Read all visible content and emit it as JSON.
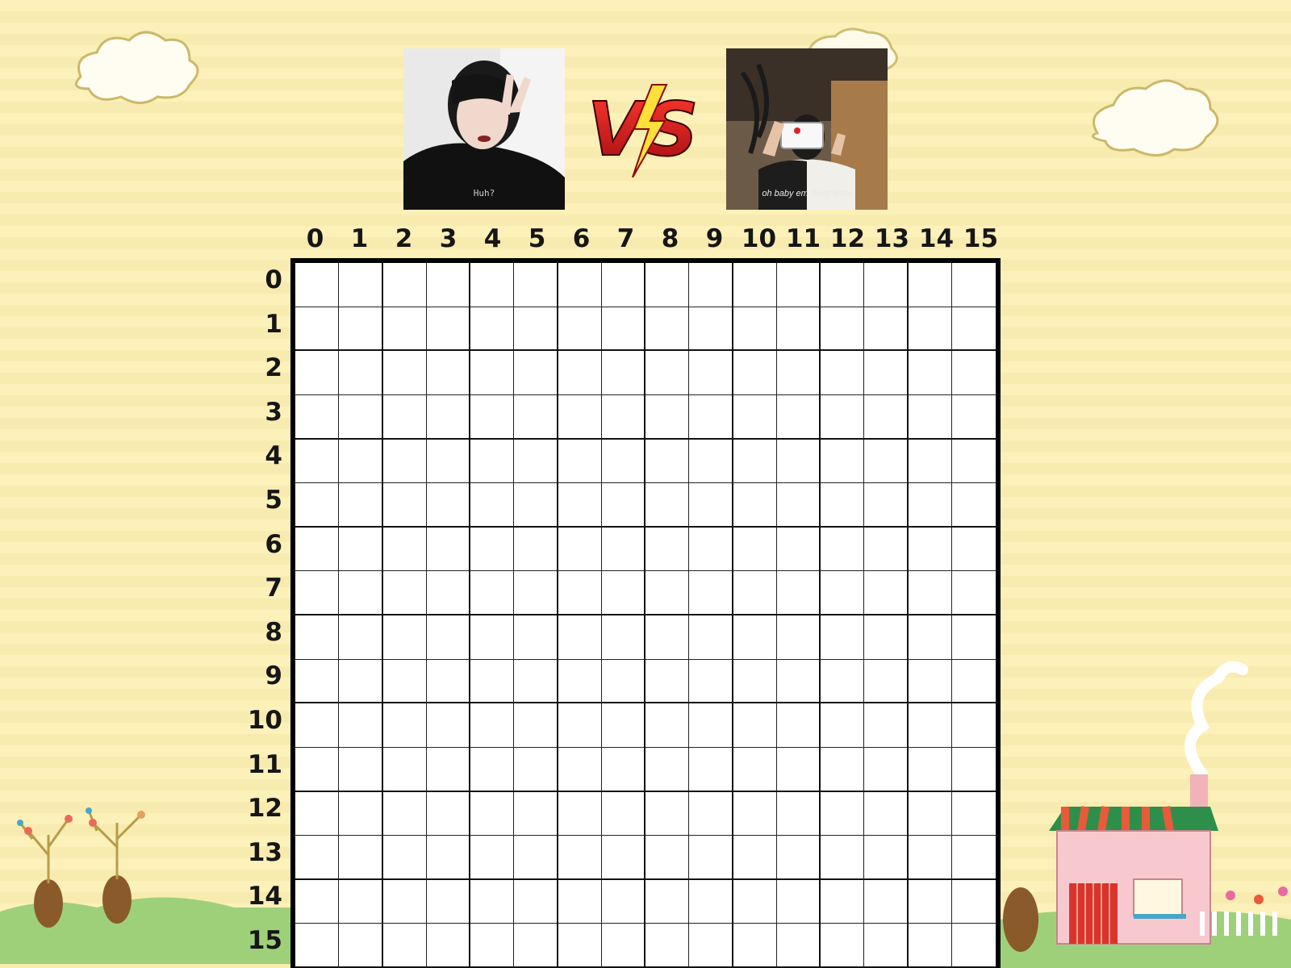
{
  "players": {
    "left": {
      "caption": "Huh?"
    },
    "right": {
      "caption": "oh baby em dung khoc"
    }
  },
  "versus": {
    "text": "VS"
  },
  "board": {
    "columns": [
      "0",
      "1",
      "2",
      "3",
      "4",
      "5",
      "6",
      "7",
      "8",
      "9",
      "10",
      "11",
      "12",
      "13",
      "14",
      "15"
    ],
    "rows": [
      "0",
      "1",
      "2",
      "3",
      "4",
      "5",
      "6",
      "7",
      "8",
      "9",
      "10",
      "11",
      "12",
      "13",
      "14",
      "15"
    ]
  },
  "colors": {
    "background": "#fcf1b9",
    "grid_line": "#000000",
    "cell": "#ffffff",
    "vs_red": "#d6161c"
  }
}
